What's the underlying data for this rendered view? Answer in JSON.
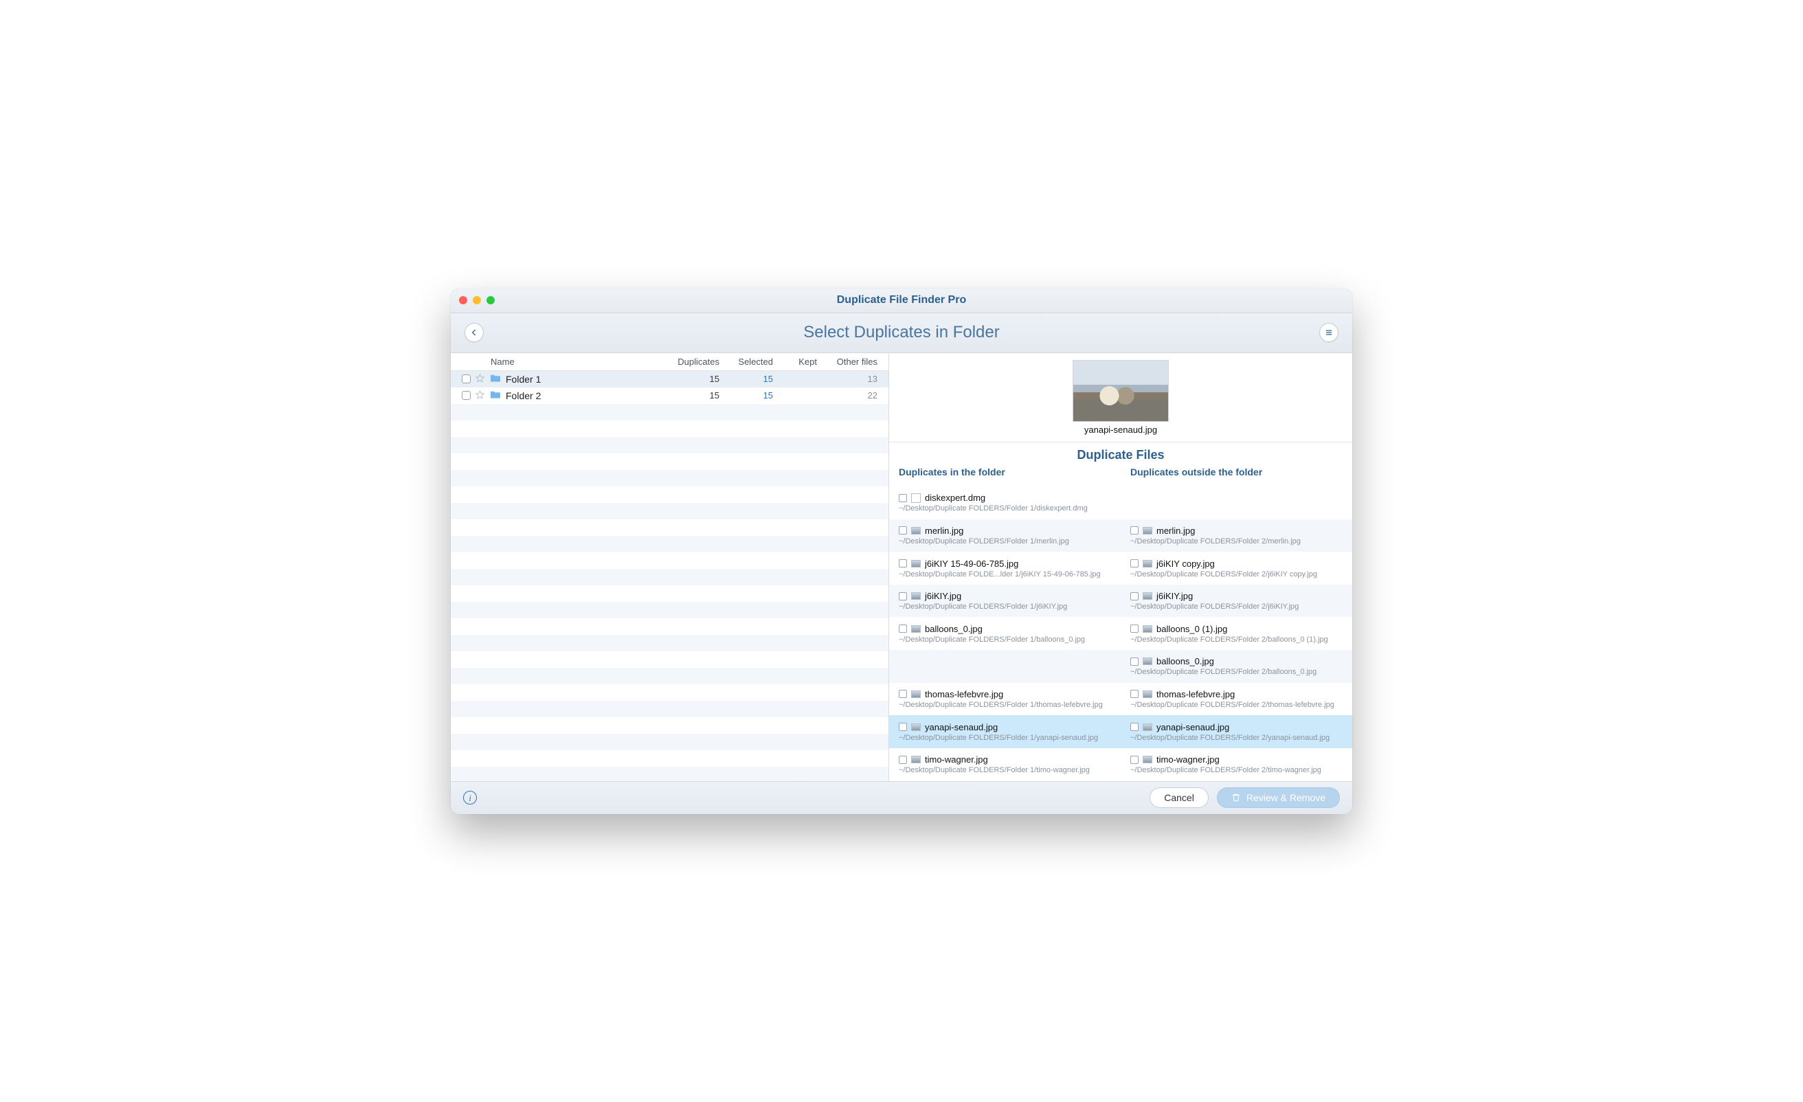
{
  "window": {
    "title": "Duplicate File Finder Pro"
  },
  "toolbar": {
    "subtitle": "Select Duplicates in Folder"
  },
  "folderTable": {
    "headers": {
      "name": "Name",
      "duplicates": "Duplicates",
      "selected": "Selected",
      "kept": "Kept",
      "other": "Other files"
    },
    "rows": [
      {
        "name": "Folder 1",
        "duplicates": "15",
        "selected": "15",
        "kept": "",
        "other": "13",
        "selected_row": true
      },
      {
        "name": "Folder 2",
        "duplicates": "15",
        "selected": "15",
        "kept": "",
        "other": "22",
        "selected_row": false
      }
    ]
  },
  "preview": {
    "filename": "yanapi-senaud.jpg"
  },
  "duplicates": {
    "section_title": "Duplicate Files",
    "col_in": "Duplicates in the folder",
    "col_out": "Duplicates outside the folder",
    "rows": [
      {
        "in": {
          "name": "diskexpert.dmg",
          "path": "~/Desktop/Duplicate FOLDERS/Folder 1/diskexpert.dmg",
          "icon": "dmg"
        },
        "out": null,
        "alt": false,
        "sel": false
      },
      {
        "in": {
          "name": "merlin.jpg",
          "path": "~/Desktop/Duplicate FOLDERS/Folder 1/merlin.jpg",
          "icon": "img"
        },
        "out": {
          "name": "merlin.jpg",
          "path": "~/Desktop/Duplicate FOLDERS/Folder 2/merlin.jpg",
          "icon": "img"
        },
        "alt": true,
        "sel": false
      },
      {
        "in": {
          "name": "j6iKIY 15-49-06-785.jpg",
          "path": "~/Desktop/Duplicate FOLDE...lder 1/j6iKIY 15-49-06-785.jpg",
          "icon": "img"
        },
        "out": {
          "name": "j6iKIY copy.jpg",
          "path": "~/Desktop/Duplicate FOLDERS/Folder 2/j6iKIY copy.jpg",
          "icon": "img"
        },
        "alt": false,
        "sel": false
      },
      {
        "in": {
          "name": "j6iKIY.jpg",
          "path": "~/Desktop/Duplicate FOLDERS/Folder 1/j6iKIY.jpg",
          "icon": "img"
        },
        "out": {
          "name": "j6iKIY.jpg",
          "path": "~/Desktop/Duplicate FOLDERS/Folder 2/j6iKIY.jpg",
          "icon": "img"
        },
        "alt": true,
        "sel": false
      },
      {
        "in": {
          "name": "balloons_0.jpg",
          "path": "~/Desktop/Duplicate FOLDERS/Folder 1/balloons_0.jpg",
          "icon": "img"
        },
        "out": {
          "name": "balloons_0 (1).jpg",
          "path": "~/Desktop/Duplicate FOLDERS/Folder 2/balloons_0 (1).jpg",
          "icon": "img"
        },
        "alt": false,
        "sel": false
      },
      {
        "in": null,
        "out": {
          "name": "balloons_0.jpg",
          "path": "~/Desktop/Duplicate FOLDERS/Folder 2/balloons_0.jpg",
          "icon": "img"
        },
        "alt": true,
        "sel": false
      },
      {
        "in": {
          "name": "thomas-lefebvre.jpg",
          "path": "~/Desktop/Duplicate FOLDERS/Folder 1/thomas-lefebvre.jpg",
          "icon": "img"
        },
        "out": {
          "name": "thomas-lefebvre.jpg",
          "path": "~/Desktop/Duplicate FOLDERS/Folder 2/thomas-lefebvre.jpg",
          "icon": "img"
        },
        "alt": false,
        "sel": false
      },
      {
        "in": {
          "name": "yanapi-senaud.jpg",
          "path": "~/Desktop/Duplicate FOLDERS/Folder 1/yanapi-senaud.jpg",
          "icon": "img"
        },
        "out": {
          "name": "yanapi-senaud.jpg",
          "path": "~/Desktop/Duplicate FOLDERS/Folder 2/yanapi-senaud.jpg",
          "icon": "img"
        },
        "alt": true,
        "sel": true
      },
      {
        "in": {
          "name": "timo-wagner.jpg",
          "path": "~/Desktop/Duplicate FOLDERS/Folder 1/timo-wagner.jpg",
          "icon": "img"
        },
        "out": {
          "name": "timo-wagner.jpg",
          "path": "~/Desktop/Duplicate FOLDERS/Folder 2/timo-wagner.jpg",
          "icon": "img"
        },
        "alt": false,
        "sel": false
      }
    ]
  },
  "footer": {
    "cancel": "Cancel",
    "primary": "Review & Remove"
  }
}
